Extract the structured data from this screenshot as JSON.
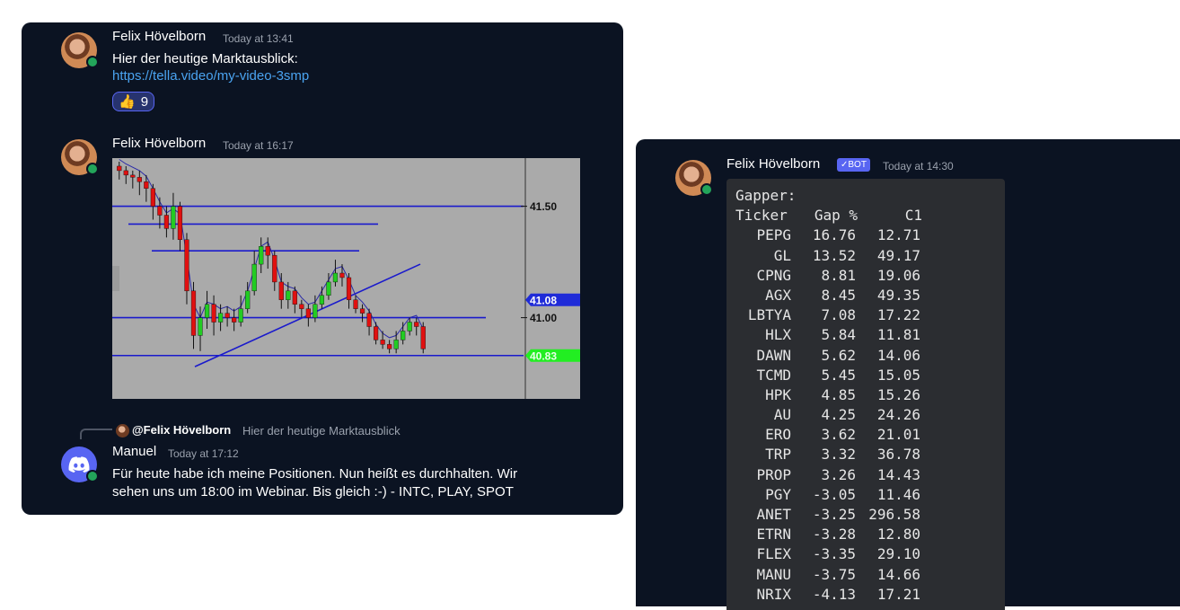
{
  "messages": {
    "m1": {
      "author": "Felix Hövelborn",
      "time": "Today at 13:41",
      "text": "Hier der heutige Marktausblick:",
      "link": "https://tella.video/my-video-3smp",
      "reaction_emoji": "👍",
      "reaction_count": "9"
    },
    "m2": {
      "author": "Felix Hövelborn",
      "time": "Today at 16:17"
    },
    "m3": {
      "reply_author": "@Felix Hövelborn",
      "reply_text": "Hier der heutige Marktausblick",
      "author": "Manuel",
      "time": "Today at 17:12",
      "text_line1": "Für heute habe ich meine Positionen. Nun heißt es durchhalten. Wir",
      "text_line2": "sehen uns um 18:00 im Webinar. Bis gleich :-) - INTC, PLAY, SPOT"
    },
    "bot": {
      "author": "Felix Hövelborn",
      "badge": "✓BOT",
      "time": "Today at 14:30",
      "title": "Gapper:",
      "headers": [
        "Ticker",
        "Gap %",
        "C1"
      ],
      "rows": [
        [
          "PEPG",
          "16.76",
          "12.71"
        ],
        [
          "GL",
          "13.52",
          "49.17"
        ],
        [
          "CPNG",
          "8.81",
          "19.06"
        ],
        [
          "AGX",
          "8.45",
          "49.35"
        ],
        [
          "LBTYA",
          "7.08",
          "17.22"
        ],
        [
          "HLX",
          "5.84",
          "11.81"
        ],
        [
          "DAWN",
          "5.62",
          "14.06"
        ],
        [
          "TCMD",
          "5.45",
          "15.05"
        ],
        [
          "HPK",
          "4.85",
          "15.26"
        ],
        [
          "AU",
          "4.25",
          "24.26"
        ],
        [
          "ERO",
          "3.62",
          "21.01"
        ],
        [
          "TRP",
          "3.32",
          "36.78"
        ],
        [
          "PROP",
          "3.26",
          "14.43"
        ],
        [
          "PGY",
          "-3.05",
          "11.46"
        ],
        [
          "ANET",
          "-3.25",
          "296.58"
        ],
        [
          "ETRN",
          "-3.28",
          "12.80"
        ],
        [
          "FLEX",
          "-3.35",
          "29.10"
        ],
        [
          "MANU",
          "-3.75",
          "14.66"
        ],
        [
          "NRIX",
          "-4.13",
          "17.21"
        ]
      ]
    }
  },
  "chart_data": {
    "type": "candlestick",
    "price_labels": [
      "41.50",
      "41.08",
      "41.00",
      "40.83"
    ],
    "highlight_colors": {
      "41.08": "#1f2bd8",
      "40.83": "#22ee22"
    },
    "candles": [
      [
        41.68,
        41.66,
        41.7,
        41.62
      ],
      [
        41.66,
        41.64,
        41.68,
        41.6
      ],
      [
        41.64,
        41.63,
        41.66,
        41.58
      ],
      [
        41.63,
        41.61,
        41.66,
        41.55
      ],
      [
        41.61,
        41.58,
        41.64,
        41.52
      ],
      [
        41.58,
        41.5,
        41.6,
        41.44
      ],
      [
        41.5,
        41.46,
        41.54,
        41.4
      ],
      [
        41.46,
        41.4,
        41.5,
        41.36
      ],
      [
        41.4,
        41.5,
        41.56,
        41.35
      ],
      [
        41.5,
        41.35,
        41.52,
        41.3
      ],
      [
        41.35,
        41.12,
        41.38,
        41.06
      ],
      [
        41.12,
        40.92,
        41.16,
        40.86
      ],
      [
        40.92,
        41.0,
        41.05,
        40.85
      ],
      [
        41.0,
        41.06,
        41.12,
        40.95
      ],
      [
        41.06,
        40.98,
        41.1,
        40.92
      ],
      [
        40.98,
        41.02,
        41.06,
        40.94
      ],
      [
        41.02,
        41.0,
        41.05,
        40.96
      ],
      [
        41.0,
        40.98,
        41.04,
        40.94
      ],
      [
        40.98,
        41.04,
        41.1,
        40.96
      ],
      [
        41.04,
        41.12,
        41.16,
        41.02
      ],
      [
        41.12,
        41.24,
        41.3,
        41.1
      ],
      [
        41.24,
        41.32,
        41.36,
        41.2
      ],
      [
        41.32,
        41.28,
        41.36,
        41.22
      ],
      [
        41.28,
        41.16,
        41.3,
        41.12
      ],
      [
        41.16,
        41.08,
        41.2,
        41.04
      ],
      [
        41.08,
        41.12,
        41.16,
        41.04
      ],
      [
        41.12,
        41.06,
        41.14,
        41.02
      ],
      [
        41.06,
        41.04,
        41.08,
        41.0
      ],
      [
        41.04,
        41.0,
        41.06,
        40.96
      ],
      [
        41.0,
        41.06,
        41.1,
        40.98
      ],
      [
        41.06,
        41.1,
        41.14,
        41.04
      ],
      [
        41.1,
        41.16,
        41.2,
        41.08
      ],
      [
        41.16,
        41.2,
        41.26,
        41.14
      ],
      [
        41.2,
        41.18,
        41.24,
        41.14
      ],
      [
        41.18,
        41.08,
        41.2,
        41.04
      ],
      [
        41.08,
        41.04,
        41.1,
        41.02
      ],
      [
        41.04,
        41.02,
        41.06,
        40.98
      ],
      [
        41.02,
        40.96,
        41.04,
        40.92
      ],
      [
        40.96,
        40.9,
        40.98,
        40.88
      ],
      [
        40.9,
        40.88,
        40.94,
        40.86
      ],
      [
        40.88,
        40.86,
        40.9,
        40.84
      ],
      [
        40.86,
        40.9,
        40.94,
        40.84
      ],
      [
        40.9,
        40.94,
        40.98,
        40.88
      ],
      [
        40.94,
        40.98,
        41.0,
        40.92
      ],
      [
        40.98,
        40.96,
        41.0,
        40.92
      ],
      [
        40.96,
        40.86,
        40.98,
        40.84
      ]
    ],
    "horizontal_lines": [
      41.5,
      41.42,
      41.3,
      41.0,
      40.83
    ],
    "trendline": [
      [
        40.78,
        41.24
      ]
    ],
    "ylim": [
      40.7,
      41.7
    ]
  }
}
